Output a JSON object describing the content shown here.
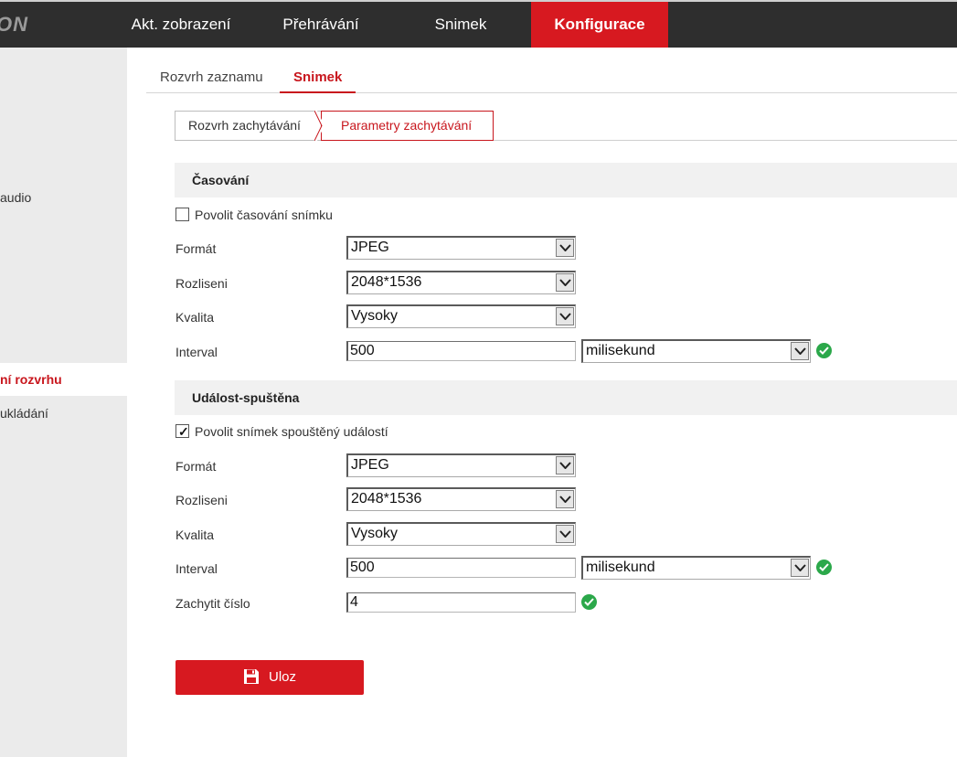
{
  "header": {
    "logo_text": "ON",
    "nav": [
      {
        "label": "Akt. zobrazení"
      },
      {
        "label": "Přehrávání"
      },
      {
        "label": "Snimek"
      },
      {
        "label": "Konfigurace"
      }
    ],
    "active_nav": "Konfigurace"
  },
  "sidebar": {
    "items": [
      {
        "label": "audio"
      },
      {
        "label": "ní rozvrhu"
      },
      {
        "label": "ukládání"
      }
    ],
    "active_item": "ní rozvrhu"
  },
  "tabs": {
    "items": [
      {
        "label": "Rozvrh zaznamu"
      },
      {
        "label": "Snimek"
      }
    ],
    "active": "Snimek"
  },
  "subtabs": {
    "items": [
      {
        "label": "Rozvrh zachytávání"
      },
      {
        "label": "Parametry zachytávání"
      }
    ],
    "active": "Parametry zachytávání"
  },
  "timing": {
    "title": "Časování",
    "enable_label": "Povolit časování snímku",
    "enabled": false,
    "format_label": "Formát",
    "format_value": "JPEG",
    "resolution_label": "Rozliseni",
    "resolution_value": "2048*1536",
    "quality_label": "Kvalita",
    "quality_value": "Vysoky",
    "interval_label": "Interval",
    "interval_value": "500",
    "interval_unit": "milisekund"
  },
  "event": {
    "title": "Událost-spuštěna",
    "enable_label": "Povolit snímek spouštěný událostí",
    "enabled": true,
    "format_label": "Formát",
    "format_value": "JPEG",
    "resolution_label": "Rozliseni",
    "resolution_value": "2048*1536",
    "quality_label": "Kvalita",
    "quality_value": "Vysoky",
    "interval_label": "Interval",
    "interval_value": "500",
    "interval_unit": "milisekund",
    "capture_count_label": "Zachytit číslo",
    "capture_count_value": "4"
  },
  "actions": {
    "save_label": "Uloz"
  },
  "colors": {
    "accent": "#d71920",
    "ok": "#2ba84a",
    "topbar": "#2e2e2e"
  }
}
